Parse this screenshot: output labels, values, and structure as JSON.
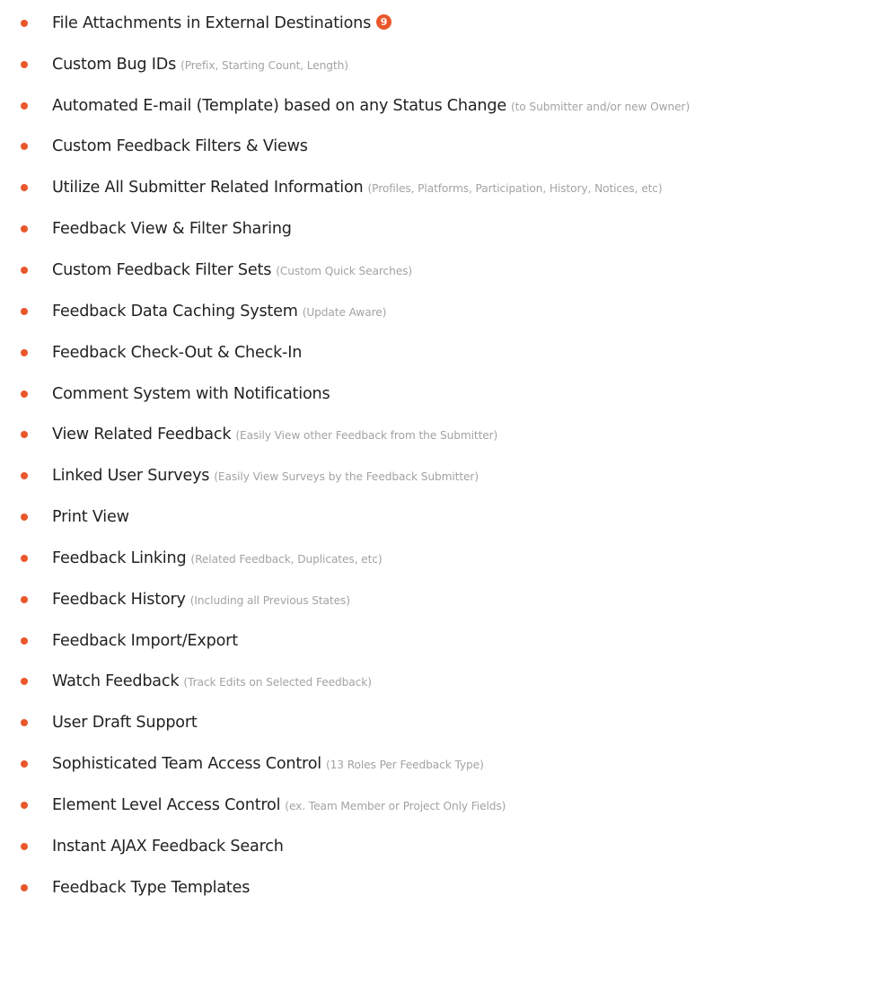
{
  "accent_color": "#e9572b",
  "features": [
    {
      "title": "File Attachments in External Destinations",
      "note": "",
      "badge": "9"
    },
    {
      "title": "Custom Bug IDs",
      "note": "(Prefix, Starting Count, Length)"
    },
    {
      "title": "Automated E-mail (Template) based on any Status Change",
      "note": "(to Submitter and/or new Owner)"
    },
    {
      "title": "Custom Feedback Filters & Views",
      "note": ""
    },
    {
      "title": "Utilize All Submitter Related Information",
      "note": "(Profiles, Platforms, Participation, History, Notices, etc)"
    },
    {
      "title": "Feedback View & Filter Sharing",
      "note": ""
    },
    {
      "title": "Custom Feedback Filter Sets",
      "note": "(Custom Quick Searches)"
    },
    {
      "title": "Feedback Data Caching System",
      "note": "(Update Aware)"
    },
    {
      "title": "Feedback Check-Out & Check-In",
      "note": ""
    },
    {
      "title": "Comment System with Notifications",
      "note": ""
    },
    {
      "title": "View Related Feedback",
      "note": "(Easily View other Feedback from the Submitter)"
    },
    {
      "title": "Linked User Surveys",
      "note": "(Easily View Surveys by the Feedback Submitter)"
    },
    {
      "title": "Print View",
      "note": ""
    },
    {
      "title": "Feedback Linking",
      "note": "(Related Feedback, Duplicates, etc)"
    },
    {
      "title": "Feedback History",
      "note": "(Including all Previous States)"
    },
    {
      "title": "Feedback Import/Export",
      "note": ""
    },
    {
      "title": "Watch Feedback",
      "note": "(Track Edits on Selected Feedback)"
    },
    {
      "title": "User Draft Support",
      "note": ""
    },
    {
      "title": "Sophisticated Team Access Control",
      "note": "(13 Roles Per Feedback Type)"
    },
    {
      "title": "Element Level Access Control",
      "note": "(ex. Team Member or Project Only Fields)"
    },
    {
      "title": "Instant AJAX Feedback Search",
      "note": ""
    },
    {
      "title": "Feedback Type Templates",
      "note": ""
    }
  ]
}
